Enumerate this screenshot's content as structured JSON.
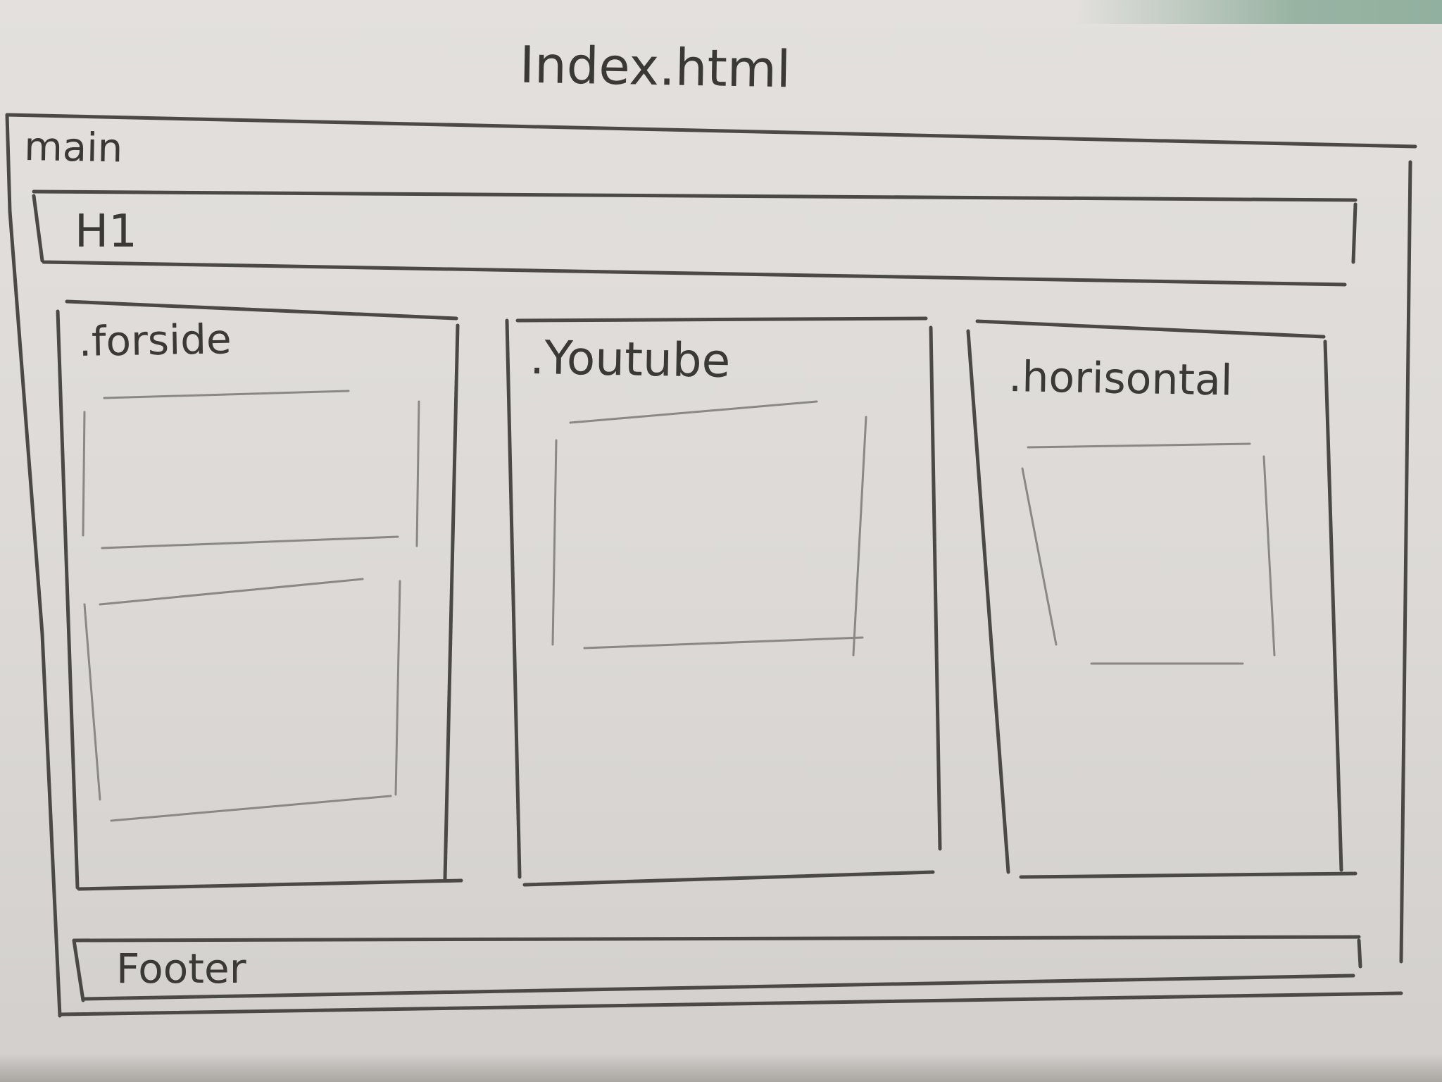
{
  "page_title": "Index.html",
  "main_label": "main",
  "header_label": "H1",
  "columns": [
    {
      "label": ".forside"
    },
    {
      "label": ".Youtube"
    },
    {
      "label": ".horisontal"
    }
  ],
  "footer_label": "Footer",
  "colors": {
    "paper": "#e0dddA",
    "pencil": "#3a3936"
  }
}
